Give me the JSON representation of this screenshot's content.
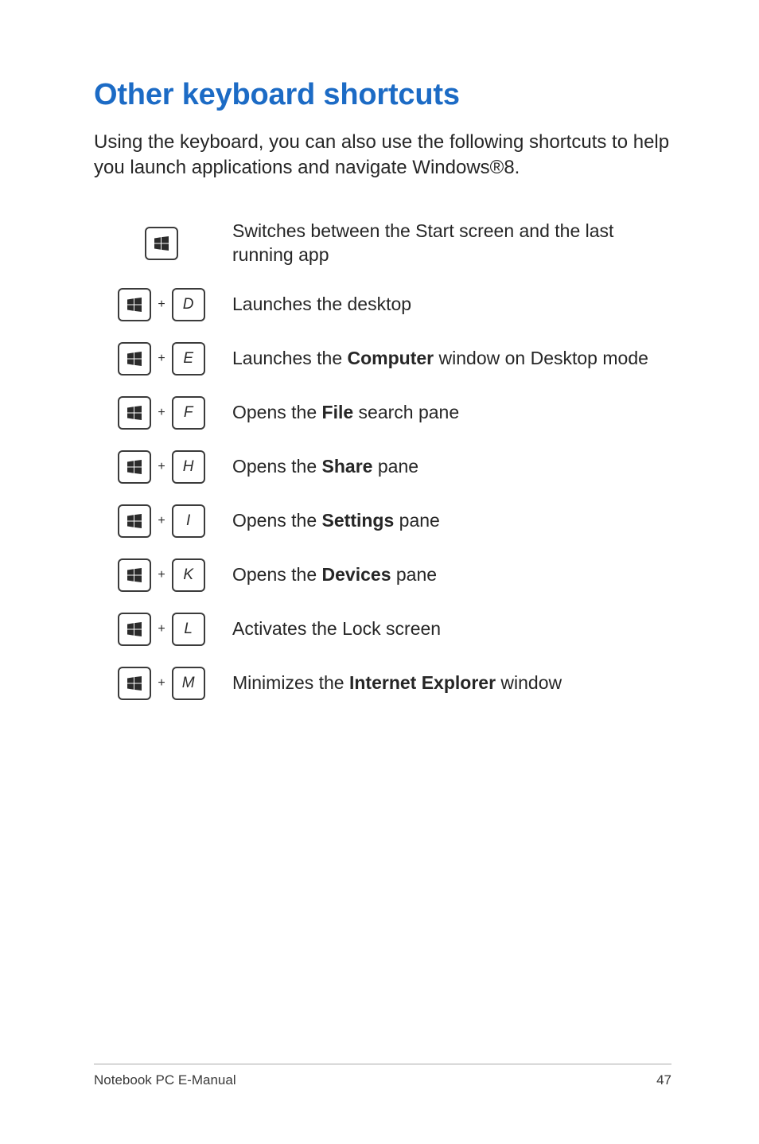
{
  "title": "Other keyboard shortcuts",
  "intro": "Using the keyboard, you can also use the following shortcuts to help you launch applications and navigate Windows®8.",
  "shortcuts": [
    {
      "combo": [
        "win"
      ],
      "plus": false,
      "desc": "Switches between the Start screen and the last running app"
    },
    {
      "combo": [
        "win",
        "D"
      ],
      "plus": true,
      "desc": "Launches the desktop"
    },
    {
      "combo": [
        "win",
        "E"
      ],
      "plus": true,
      "desc": "Launches the <strong>Computer</strong> window on Desktop mode"
    },
    {
      "combo": [
        "win",
        "F"
      ],
      "plus": true,
      "desc": "Opens the <strong>File</strong> search pane"
    },
    {
      "combo": [
        "win",
        "H"
      ],
      "plus": true,
      "desc": "Opens the <strong>Share</strong> pane"
    },
    {
      "combo": [
        "win",
        "I"
      ],
      "plus": true,
      "desc": "Opens the <strong>Settings</strong> pane"
    },
    {
      "combo": [
        "win",
        "K"
      ],
      "plus": true,
      "desc": "Opens the <strong>Devices</strong> pane"
    },
    {
      "combo": [
        "win",
        "L"
      ],
      "plus": true,
      "desc": "Activates the Lock screen"
    },
    {
      "combo": [
        "win",
        "M"
      ],
      "plus": true,
      "desc": "Minimizes the <strong>Internet Explorer</strong> window"
    }
  ],
  "footer": {
    "left": "Notebook PC E-Manual",
    "right": "47"
  },
  "colors": {
    "heading": "#1c6bc5",
    "text": "#262626",
    "border": "#3b3b3b"
  }
}
